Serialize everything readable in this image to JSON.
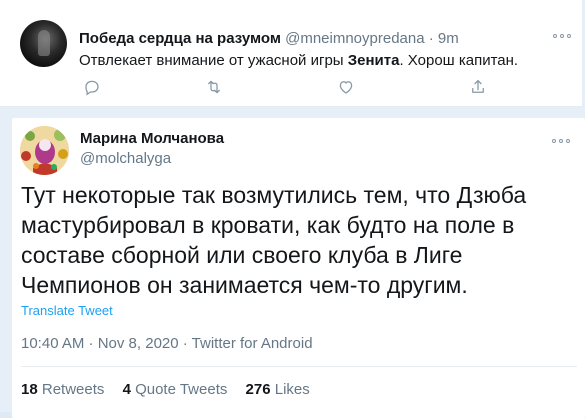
{
  "reply_tweet": {
    "display_name": "Победа сердца на разумом",
    "handle": "@mneimnoypredana",
    "separator": "·",
    "time": "9m",
    "text_before": "Отвлекает внимание от ужасной игры ",
    "text_bold": "Зенита",
    "text_after": ". Хорош капитан.",
    "actions": [
      "reply-icon",
      "retweet-icon",
      "like-icon",
      "share-icon"
    ]
  },
  "main_tweet": {
    "display_name": "Марина Молчанова",
    "handle": "@molchalyga",
    "text": "Тут некоторые так возмутились тем, что Дзюба мастурбировал в кровати, как будто на поле в составе сборной или своего клуба в Лиге Чемпионов он занимается чем-то другим.",
    "translate_label": "Translate Tweet",
    "meta": "10:40 AM · Nov 8, 2020 · Twitter for Android",
    "stats": [
      {
        "count": "18",
        "label": "Retweets"
      },
      {
        "count": "4",
        "label": "Quote Tweets"
      },
      {
        "count": "276",
        "label": "Likes"
      }
    ]
  },
  "colors": {
    "link": "#1da1f2",
    "muted": "#657786",
    "text": "#14171a",
    "background": "#e6eef8"
  }
}
